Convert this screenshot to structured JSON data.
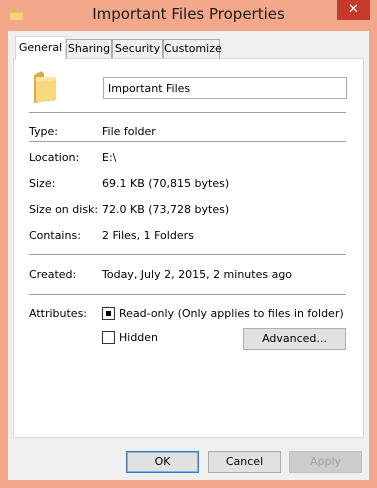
{
  "window": {
    "title": "Important Files Properties",
    "close_glyph": "✕",
    "accent": "#f3a78b"
  },
  "tabs": [
    {
      "label": "General",
      "active": true
    },
    {
      "label": "Sharing"
    },
    {
      "label": "Security"
    },
    {
      "label": "Customize"
    }
  ],
  "general": {
    "name_value": "Important Files",
    "type_label": "Type:",
    "type_value": "File folder",
    "location_label": "Location:",
    "location_value": "E:\\",
    "size_label": "Size:",
    "size_value": "69.1 KB (70,815 bytes)",
    "size_on_disk_label": "Size on disk:",
    "size_on_disk_value": "72.0 KB (73,728 bytes)",
    "contains_label": "Contains:",
    "contains_value": "2 Files, 1 Folders",
    "created_label": "Created:",
    "created_value": "Today, July 2, 2015, 2 minutes ago",
    "attributes_label": "Attributes:",
    "readonly_label": "Read-only (Only applies to files in folder)",
    "readonly_state": "indeterminate",
    "hidden_label": "Hidden",
    "hidden_checked": false,
    "advanced_label": "Advanced..."
  },
  "buttons": {
    "ok": "OK",
    "cancel": "Cancel",
    "apply": "Apply"
  },
  "icons": {
    "title": "folder-icon",
    "large": "folder-icon"
  }
}
